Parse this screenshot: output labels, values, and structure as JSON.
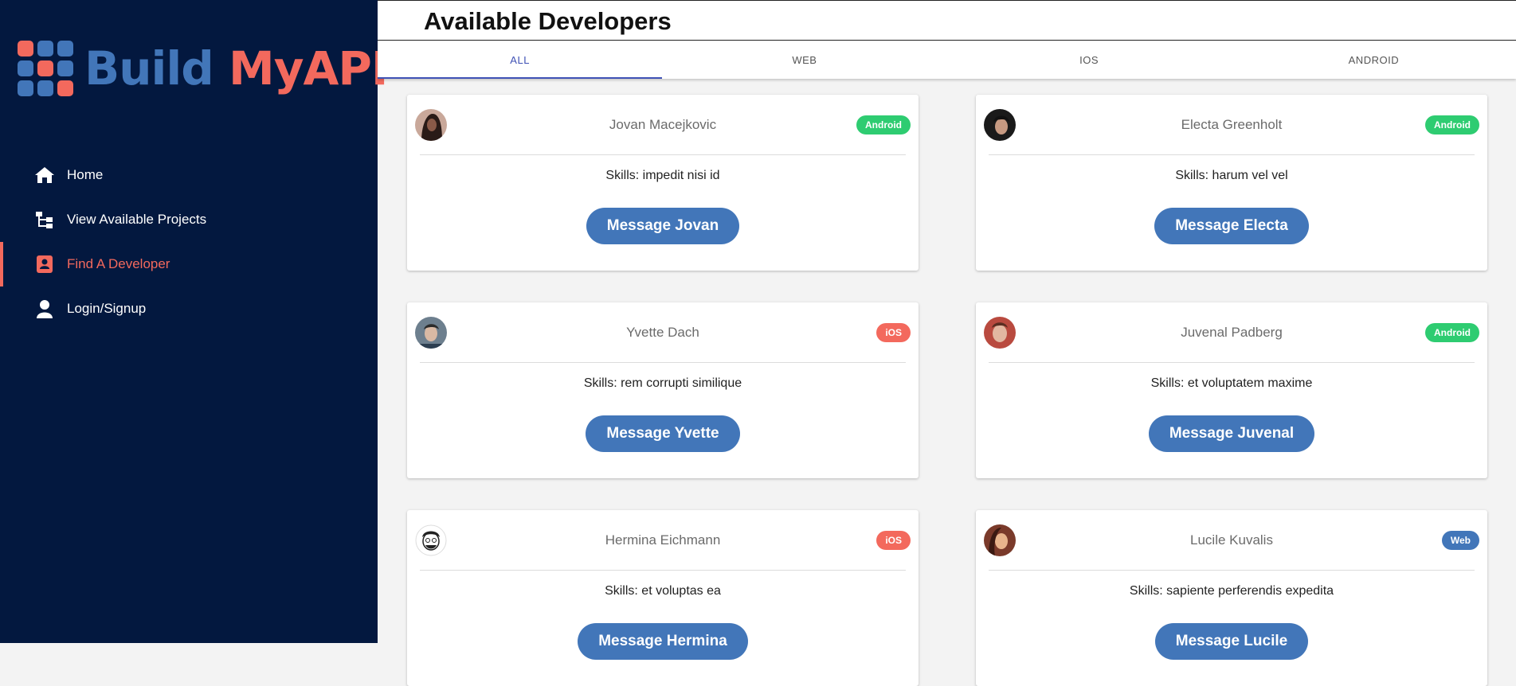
{
  "brand": {
    "word1": "Build",
    "word2": "MyAPP",
    "colors": {
      "blue": "#4276b9",
      "coral": "#f3695d",
      "sidebar_bg": "#03183f"
    }
  },
  "sidebar": {
    "items": [
      {
        "label": "Home",
        "icon": "home-icon",
        "active": false
      },
      {
        "label": "View Available Projects",
        "icon": "project-tree-icon",
        "active": false
      },
      {
        "label": "Find A Developer",
        "icon": "contact-card-icon",
        "active": true
      },
      {
        "label": "Login/Signup",
        "icon": "user-icon",
        "active": false
      }
    ]
  },
  "header": {
    "title": "Available Developers"
  },
  "tabs": [
    {
      "label": "ALL",
      "active": true
    },
    {
      "label": "WEB",
      "active": false
    },
    {
      "label": "IOS",
      "active": false
    },
    {
      "label": "ANDROID",
      "active": false
    }
  ],
  "developers": [
    {
      "name": "Jovan Macejkovic",
      "badge": "Android",
      "badge_color": "#2ecc71",
      "skills": "Skills: impedit nisi id",
      "button": "Message Jovan"
    },
    {
      "name": "Electa Greenholt",
      "badge": "Android",
      "badge_color": "#2ecc71",
      "skills": "Skills: harum vel vel",
      "button": "Message Electa"
    },
    {
      "name": "Yvette Dach",
      "badge": "iOS",
      "badge_color": "#f3695d",
      "skills": "Skills: rem corrupti similique",
      "button": "Message Yvette"
    },
    {
      "name": "Juvenal Padberg",
      "badge": "Android",
      "badge_color": "#2ecc71",
      "skills": "Skills: et voluptatem maxime",
      "button": "Message Juvenal"
    },
    {
      "name": "Hermina Eichmann",
      "badge": "iOS",
      "badge_color": "#f3695d",
      "skills": "Skills: et voluptas ea",
      "button": "Message Hermina"
    },
    {
      "name": "Lucile Kuvalis",
      "badge": "Web",
      "badge_color": "#4276b9",
      "skills": "Skills: sapiente perferendis expedita",
      "button": "Message Lucile"
    }
  ]
}
